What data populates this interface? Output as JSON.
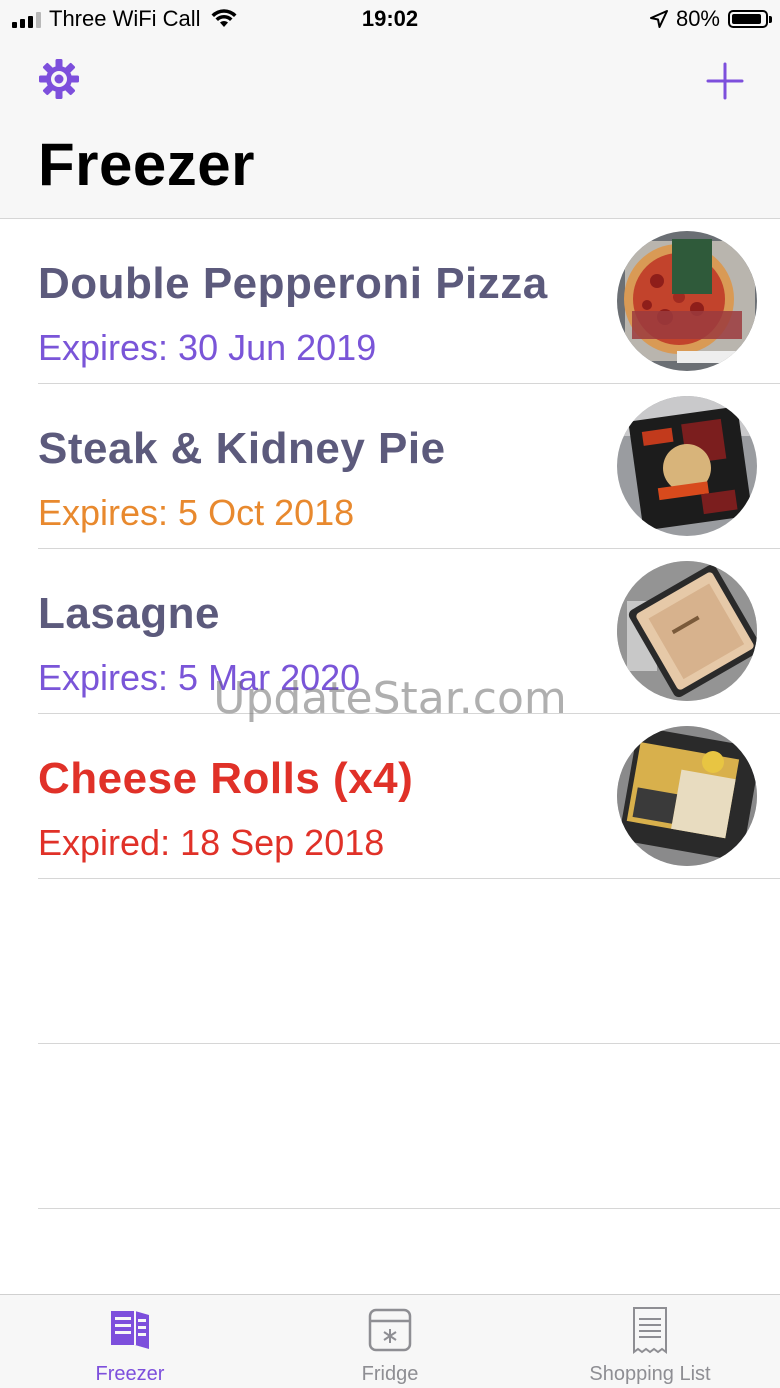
{
  "status_bar": {
    "carrier": "Three WiFi Call",
    "time": "19:02",
    "battery": "80%",
    "battery_level": 0.8
  },
  "header": {
    "title": "Freezer",
    "settings_icon": "gear-icon",
    "add_icon": "plus-icon",
    "accent_color": "#7d4fdc"
  },
  "items": [
    {
      "name": "Double Pepperoni Pizza",
      "expiry": "Expires: 30 Jun 2019",
      "status": "ok",
      "name_color": "#5c5a7c",
      "expiry_color": "#7a55d8"
    },
    {
      "name": "Steak & Kidney Pie",
      "expiry": "Expires: 5 Oct 2018",
      "status": "soon",
      "name_color": "#5c5a7c",
      "expiry_color": "#e8892e"
    },
    {
      "name": "Lasagne",
      "expiry": "Expires: 5 Mar 2020",
      "status": "ok",
      "name_color": "#5c5a7c",
      "expiry_color": "#7a55d8"
    },
    {
      "name": "Cheese Rolls (x4)",
      "expiry": "Expired: 18 Sep 2018",
      "status": "expired",
      "name_color": "#e03128",
      "expiry_color": "#e03128"
    }
  ],
  "watermark": "UpdateStar.com",
  "tabs": [
    {
      "label": "Freezer",
      "icon": "freezer-icon",
      "active": true
    },
    {
      "label": "Fridge",
      "icon": "fridge-icon",
      "active": false
    },
    {
      "label": "Shopping List",
      "icon": "shopping-list-icon",
      "active": false
    }
  ]
}
